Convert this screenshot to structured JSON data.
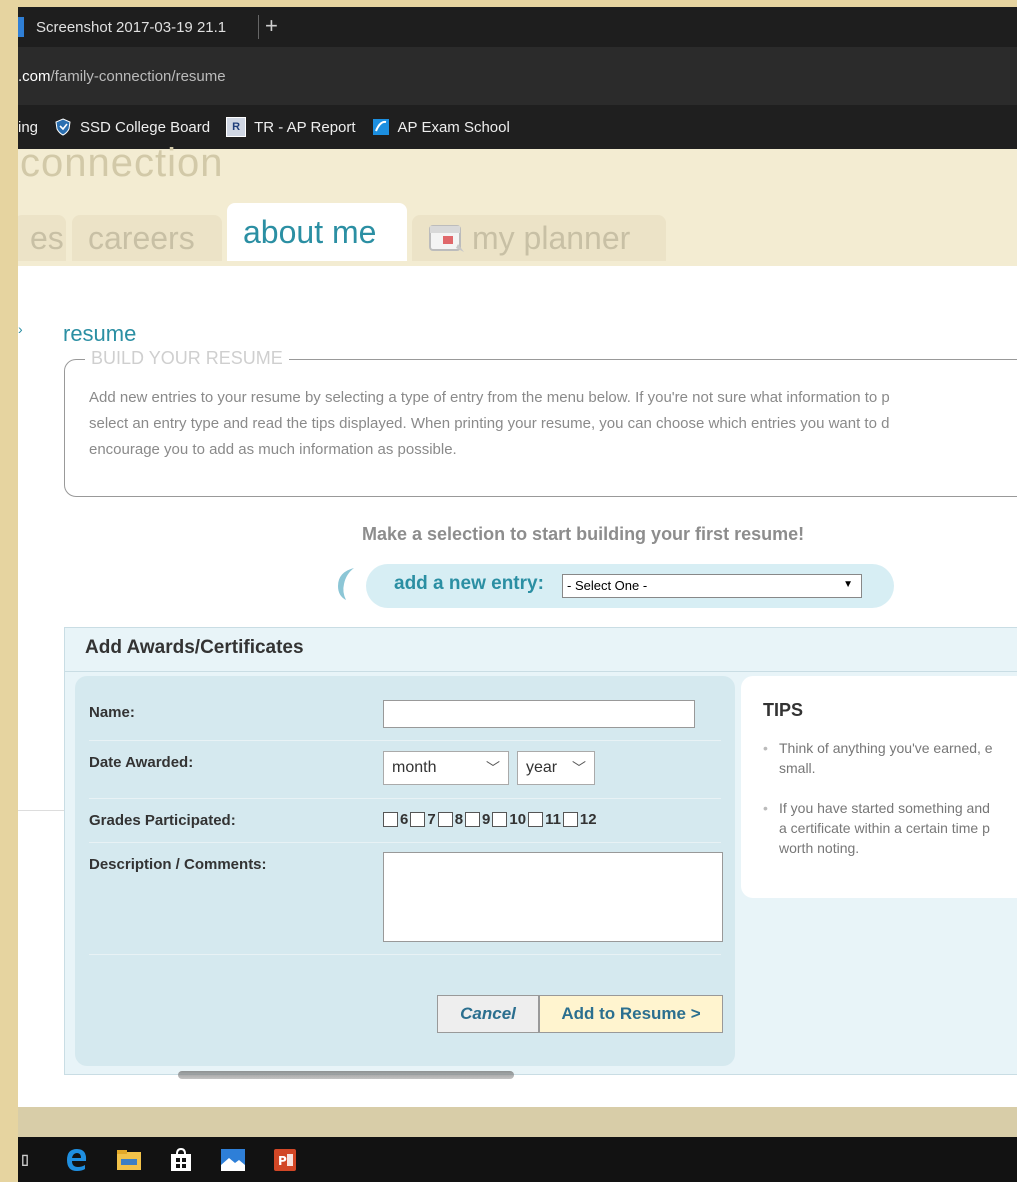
{
  "browser": {
    "tab_title": "Screenshot 2017-03-19 21.1",
    "new_tab_glyph": "+",
    "url_host": ".com",
    "url_path": "/family-connection/resume",
    "favorites": [
      {
        "label": "ing",
        "icon": ""
      },
      {
        "label": "SSD College Board",
        "icon": "shield-icon"
      },
      {
        "label": "TR - AP Report",
        "icon": "tr-icon"
      },
      {
        "label": "AP Exam School",
        "icon": "ap-icon"
      }
    ]
  },
  "site": {
    "brand_fragment": "connection",
    "nav_tabs": [
      {
        "label": "es"
      },
      {
        "label": "careers"
      },
      {
        "label": "about me",
        "active": true
      },
      {
        "label": "my planner"
      }
    ]
  },
  "resume": {
    "title": "resume",
    "build_legend": "BUILD YOUR RESUME",
    "build_text": [
      "Add new entries to your resume by selecting a type of entry from the menu below. If you're not sure what information to p",
      "select an entry type and read the tips displayed. When printing your resume, you can choose which entries you want to d",
      "encourage you to add as much information as possible."
    ],
    "prompt": "Make a selection to start building your first resume!",
    "add_entry_label": "add a new entry:",
    "add_entry_selected": "- Select One -"
  },
  "form": {
    "header": "Add Awards/Certificates",
    "name_label": "Name:",
    "name_value": "",
    "date_label": "Date Awarded:",
    "month_selected": "month",
    "year_selected": "year",
    "grades_label": "Grades Participated:",
    "grades": [
      "6",
      "7",
      "8",
      "9",
      "10",
      "11",
      "12"
    ],
    "desc_label": "Description / Comments:",
    "desc_value": "",
    "cancel_label": "Cancel",
    "add_label": "Add to Resume >"
  },
  "tips": {
    "title": "TIPS",
    "items": [
      "Think of anything you've earned, e\nsmall.",
      "If you have started something and\na certificate within a certain time p\nworth noting."
    ]
  },
  "taskbar": {
    "items": [
      "task-view-icon",
      "edge-icon",
      "file-explorer-icon",
      "store-icon",
      "photos-icon",
      "powerpoint-icon"
    ]
  }
}
